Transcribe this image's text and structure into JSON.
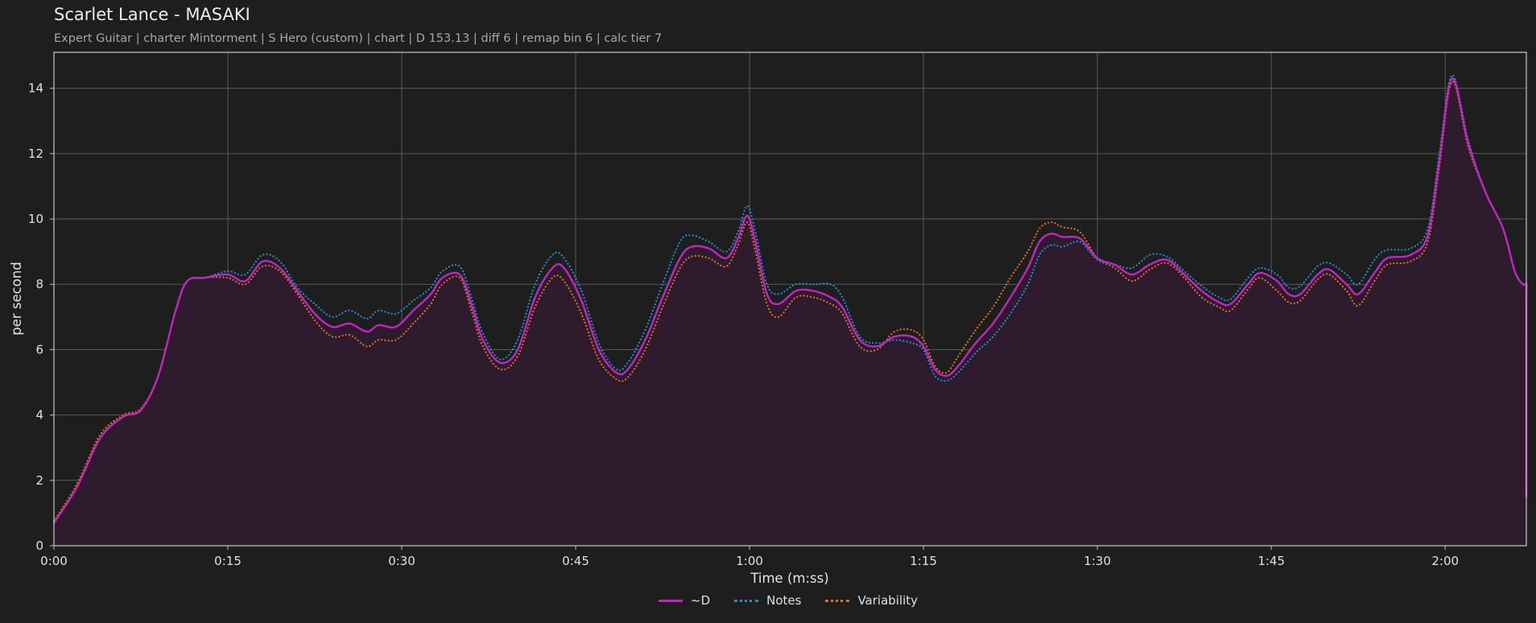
{
  "header": {
    "title": "Scarlet Lance - MASAKI",
    "subtitle": "Expert Guitar  |  charter Mintorment  |  S Hero (custom)  |  chart  |  D 153.13  |  diff 6  |  remap bin 6  |  calc tier 7"
  },
  "colors": {
    "background": "#1e1e1e",
    "fill": "#2e1b2d",
    "d_line": "#c026c0",
    "notes_line": "#1f8fd0",
    "variability_line": "#e07020",
    "grid": "#5a5a5a",
    "axis": "#bdbdbd"
  },
  "chart_data": {
    "type": "line",
    "xlabel": "Time (m:ss)",
    "ylabel": "per second",
    "xlim": [
      0,
      127
    ],
    "ylim": [
      0,
      15.1
    ],
    "x_ticks": [
      {
        "value": 0,
        "label": "0:00"
      },
      {
        "value": 15,
        "label": "0:15"
      },
      {
        "value": 30,
        "label": "0:30"
      },
      {
        "value": 45,
        "label": "0:45"
      },
      {
        "value": 60,
        "label": "1:00"
      },
      {
        "value": 75,
        "label": "1:15"
      },
      {
        "value": 90,
        "label": "1:30"
      },
      {
        "value": 105,
        "label": "1:45"
      },
      {
        "value": 120,
        "label": "2:00"
      }
    ],
    "y_ticks": [
      0,
      2,
      4,
      6,
      8,
      10,
      12,
      14
    ],
    "grid": true,
    "legend_position": "bottom-center",
    "series": [
      {
        "name": "~D",
        "style": "solid",
        "fill": true,
        "points": [
          [
            0,
            0.7
          ],
          [
            2,
            1.8
          ],
          [
            4,
            3.3
          ],
          [
            6,
            3.95
          ],
          [
            7.5,
            4.15
          ],
          [
            9,
            5.2
          ],
          [
            10.5,
            7.2
          ],
          [
            11.5,
            8.1
          ],
          [
            13,
            8.2
          ],
          [
            15,
            8.3
          ],
          [
            16.5,
            8.1
          ],
          [
            18,
            8.7
          ],
          [
            19.5,
            8.5
          ],
          [
            21,
            7.8
          ],
          [
            22.5,
            7.1
          ],
          [
            24,
            6.7
          ],
          [
            25.5,
            6.8
          ],
          [
            27,
            6.55
          ],
          [
            28,
            6.75
          ],
          [
            29.5,
            6.7
          ],
          [
            31,
            7.2
          ],
          [
            32.5,
            7.7
          ],
          [
            33.5,
            8.2
          ],
          [
            35,
            8.3
          ],
          [
            36,
            7.4
          ],
          [
            37,
            6.3
          ],
          [
            38.5,
            5.6
          ],
          [
            40,
            6.0
          ],
          [
            41.5,
            7.6
          ],
          [
            43,
            8.5
          ],
          [
            44,
            8.5
          ],
          [
            45.5,
            7.5
          ],
          [
            47,
            6.0
          ],
          [
            48.5,
            5.3
          ],
          [
            49.5,
            5.4
          ],
          [
            51,
            6.3
          ],
          [
            52.5,
            7.6
          ],
          [
            54,
            8.8
          ],
          [
            55,
            9.15
          ],
          [
            56.5,
            9.1
          ],
          [
            58,
            8.8
          ],
          [
            59,
            9.4
          ],
          [
            59.8,
            10.1
          ],
          [
            60.5,
            9.3
          ],
          [
            61.5,
            7.7
          ],
          [
            62.5,
            7.4
          ],
          [
            64,
            7.8
          ],
          [
            65.5,
            7.8
          ],
          [
            67,
            7.6
          ],
          [
            68,
            7.3
          ],
          [
            69.5,
            6.3
          ],
          [
            71,
            6.1
          ],
          [
            72.5,
            6.4
          ],
          [
            74,
            6.4
          ],
          [
            75,
            6.1
          ],
          [
            76,
            5.4
          ],
          [
            77,
            5.2
          ],
          [
            78,
            5.5
          ],
          [
            79.5,
            6.2
          ],
          [
            81,
            6.8
          ],
          [
            82.5,
            7.6
          ],
          [
            84,
            8.5
          ],
          [
            85,
            9.3
          ],
          [
            86,
            9.55
          ],
          [
            87,
            9.45
          ],
          [
            88.5,
            9.4
          ],
          [
            90,
            8.8
          ],
          [
            91.5,
            8.6
          ],
          [
            93,
            8.3
          ],
          [
            94.5,
            8.6
          ],
          [
            96,
            8.75
          ],
          [
            97.5,
            8.3
          ],
          [
            99,
            7.8
          ],
          [
            100.5,
            7.45
          ],
          [
            101.5,
            7.4
          ],
          [
            103,
            8.0
          ],
          [
            104,
            8.35
          ],
          [
            105.5,
            8.1
          ],
          [
            106.5,
            7.7
          ],
          [
            107.5,
            7.7
          ],
          [
            109,
            8.3
          ],
          [
            110,
            8.45
          ],
          [
            111.5,
            8.0
          ],
          [
            112.5,
            7.7
          ],
          [
            114,
            8.4
          ],
          [
            115,
            8.8
          ],
          [
            117,
            8.9
          ],
          [
            118.5,
            9.5
          ],
          [
            119.5,
            11.8
          ],
          [
            120.6,
            14.3
          ],
          [
            122,
            12.3
          ],
          [
            123.5,
            10.8
          ],
          [
            125,
            9.7
          ],
          [
            126,
            8.4
          ],
          [
            126.7,
            8.0
          ],
          [
            127.5,
            8.0
          ],
          [
            128.3,
            7.6
          ],
          [
            129,
            5.5
          ],
          [
            129.8,
            2.8
          ],
          [
            130.3,
            1.5
          ]
        ]
      },
      {
        "name": "Notes",
        "style": "dotted",
        "fill": false,
        "points": [
          [
            0,
            0.7
          ],
          [
            2,
            1.8
          ],
          [
            4,
            3.3
          ],
          [
            6,
            3.95
          ],
          [
            7.5,
            4.15
          ],
          [
            9,
            5.2
          ],
          [
            10.5,
            7.2
          ],
          [
            11.5,
            8.1
          ],
          [
            13,
            8.2
          ],
          [
            15,
            8.4
          ],
          [
            16.5,
            8.3
          ],
          [
            18,
            8.9
          ],
          [
            19.5,
            8.7
          ],
          [
            21,
            7.9
          ],
          [
            22.5,
            7.4
          ],
          [
            24,
            7.0
          ],
          [
            25.5,
            7.2
          ],
          [
            27,
            6.95
          ],
          [
            28,
            7.2
          ],
          [
            29.5,
            7.1
          ],
          [
            31,
            7.5
          ],
          [
            32.5,
            7.9
          ],
          [
            33.5,
            8.4
          ],
          [
            35,
            8.55
          ],
          [
            36,
            7.6
          ],
          [
            37,
            6.5
          ],
          [
            38.5,
            5.7
          ],
          [
            40,
            6.3
          ],
          [
            41.5,
            8.0
          ],
          [
            43,
            8.9
          ],
          [
            44,
            8.8
          ],
          [
            45.5,
            7.8
          ],
          [
            47,
            6.2
          ],
          [
            48.5,
            5.4
          ],
          [
            49.5,
            5.6
          ],
          [
            51,
            6.6
          ],
          [
            52.5,
            8.0
          ],
          [
            54,
            9.3
          ],
          [
            55,
            9.5
          ],
          [
            56.5,
            9.3
          ],
          [
            58,
            9.0
          ],
          [
            59,
            9.6
          ],
          [
            59.8,
            10.4
          ],
          [
            60.5,
            9.6
          ],
          [
            61.5,
            8.0
          ],
          [
            62.5,
            7.7
          ],
          [
            64,
            8.0
          ],
          [
            65.5,
            8.0
          ],
          [
            67,
            8.0
          ],
          [
            68,
            7.6
          ],
          [
            69.5,
            6.4
          ],
          [
            71,
            6.2
          ],
          [
            72.5,
            6.3
          ],
          [
            74,
            6.2
          ],
          [
            75,
            6.0
          ],
          [
            76,
            5.2
          ],
          [
            77,
            5.05
          ],
          [
            78,
            5.3
          ],
          [
            79.5,
            5.9
          ],
          [
            81,
            6.4
          ],
          [
            82.5,
            7.1
          ],
          [
            84,
            8.0
          ],
          [
            85,
            8.9
          ],
          [
            86,
            9.2
          ],
          [
            87,
            9.15
          ],
          [
            88.5,
            9.3
          ],
          [
            90,
            8.75
          ],
          [
            91.5,
            8.6
          ],
          [
            93,
            8.5
          ],
          [
            94.5,
            8.9
          ],
          [
            96,
            8.85
          ],
          [
            97.5,
            8.4
          ],
          [
            99,
            7.95
          ],
          [
            100.5,
            7.6
          ],
          [
            101.5,
            7.55
          ],
          [
            103,
            8.2
          ],
          [
            104,
            8.5
          ],
          [
            105.5,
            8.3
          ],
          [
            106.5,
            7.9
          ],
          [
            107.5,
            7.95
          ],
          [
            109,
            8.55
          ],
          [
            110,
            8.65
          ],
          [
            111.5,
            8.3
          ],
          [
            112.5,
            8.0
          ],
          [
            114,
            8.8
          ],
          [
            115,
            9.05
          ],
          [
            117,
            9.1
          ],
          [
            118.5,
            9.7
          ],
          [
            119.5,
            12.0
          ],
          [
            120.6,
            14.4
          ],
          [
            122,
            12.4
          ],
          [
            123.5,
            10.8
          ],
          [
            125,
            9.7
          ],
          [
            126,
            8.4
          ],
          [
            126.7,
            8.0
          ],
          [
            127.5,
            8.0
          ],
          [
            128.3,
            7.6
          ],
          [
            129,
            5.5
          ],
          [
            129.8,
            2.8
          ],
          [
            130.3,
            1.5
          ]
        ]
      },
      {
        "name": "Variability",
        "style": "dotted",
        "fill": false,
        "points": [
          [
            0,
            0.75
          ],
          [
            2,
            1.9
          ],
          [
            4,
            3.4
          ],
          [
            6,
            4.0
          ],
          [
            7.5,
            4.2
          ],
          [
            9,
            5.2
          ],
          [
            10.5,
            7.2
          ],
          [
            11.5,
            8.1
          ],
          [
            13,
            8.2
          ],
          [
            15,
            8.2
          ],
          [
            16.5,
            8.0
          ],
          [
            18,
            8.55
          ],
          [
            19.5,
            8.4
          ],
          [
            21,
            7.7
          ],
          [
            22.5,
            6.9
          ],
          [
            24,
            6.4
          ],
          [
            25.5,
            6.45
          ],
          [
            27,
            6.1
          ],
          [
            28,
            6.3
          ],
          [
            29.5,
            6.3
          ],
          [
            31,
            6.8
          ],
          [
            32.5,
            7.4
          ],
          [
            33.5,
            8.0
          ],
          [
            35,
            8.2
          ],
          [
            36,
            7.2
          ],
          [
            37,
            6.1
          ],
          [
            38.5,
            5.4
          ],
          [
            40,
            5.8
          ],
          [
            41.5,
            7.3
          ],
          [
            43,
            8.2
          ],
          [
            44,
            8.1
          ],
          [
            45.5,
            7.1
          ],
          [
            47,
            5.7
          ],
          [
            48.5,
            5.1
          ],
          [
            49.5,
            5.15
          ],
          [
            51,
            6.0
          ],
          [
            52.5,
            7.3
          ],
          [
            54,
            8.5
          ],
          [
            55,
            8.85
          ],
          [
            56.5,
            8.8
          ],
          [
            58,
            8.55
          ],
          [
            59,
            9.2
          ],
          [
            59.8,
            9.9
          ],
          [
            60.5,
            9.0
          ],
          [
            61.5,
            7.4
          ],
          [
            62.5,
            7.0
          ],
          [
            64,
            7.6
          ],
          [
            65.5,
            7.6
          ],
          [
            67,
            7.4
          ],
          [
            68,
            7.1
          ],
          [
            69.5,
            6.1
          ],
          [
            71,
            6.0
          ],
          [
            72.5,
            6.55
          ],
          [
            74,
            6.6
          ],
          [
            75,
            6.3
          ],
          [
            76,
            5.5
          ],
          [
            77,
            5.3
          ],
          [
            78,
            5.8
          ],
          [
            79.5,
            6.6
          ],
          [
            81,
            7.3
          ],
          [
            82.5,
            8.2
          ],
          [
            84,
            9.0
          ],
          [
            85,
            9.7
          ],
          [
            86,
            9.9
          ],
          [
            87,
            9.75
          ],
          [
            88.5,
            9.6
          ],
          [
            90,
            8.8
          ],
          [
            91.5,
            8.5
          ],
          [
            93,
            8.1
          ],
          [
            94.5,
            8.45
          ],
          [
            96,
            8.65
          ],
          [
            97.5,
            8.2
          ],
          [
            99,
            7.6
          ],
          [
            100.5,
            7.3
          ],
          [
            101.5,
            7.2
          ],
          [
            103,
            7.85
          ],
          [
            104,
            8.2
          ],
          [
            105.5,
            7.8
          ],
          [
            106.5,
            7.45
          ],
          [
            107.5,
            7.5
          ],
          [
            109,
            8.15
          ],
          [
            110,
            8.3
          ],
          [
            111.5,
            7.8
          ],
          [
            112.5,
            7.35
          ],
          [
            114,
            8.15
          ],
          [
            115,
            8.6
          ],
          [
            117,
            8.7
          ],
          [
            118.5,
            9.3
          ],
          [
            119.5,
            11.6
          ],
          [
            120.6,
            14.2
          ],
          [
            122,
            12.2
          ],
          [
            123.5,
            10.8
          ],
          [
            125,
            9.7
          ],
          [
            126,
            8.4
          ],
          [
            126.7,
            8.0
          ],
          [
            127.5,
            8.0
          ],
          [
            128.3,
            7.6
          ],
          [
            129,
            5.5
          ],
          [
            129.8,
            2.8
          ],
          [
            130.3,
            1.5
          ]
        ]
      }
    ]
  }
}
